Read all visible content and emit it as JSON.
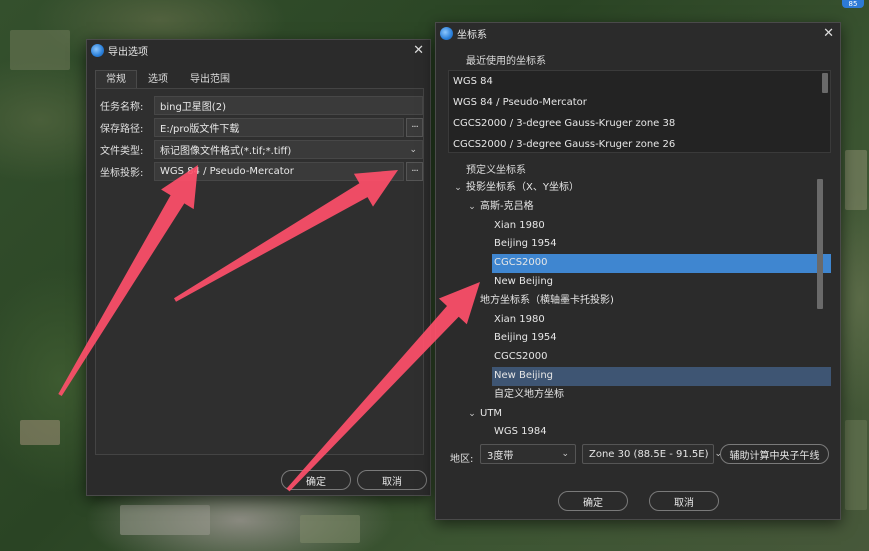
{
  "colors": {
    "arrow": "#ff4f6a",
    "selection": "#3f86d0",
    "selection_muted": "#3e5573"
  },
  "badge": "85",
  "export_dialog": {
    "title": "导出选项",
    "tabs": [
      "常规",
      "选项",
      "导出范围"
    ],
    "fields": {
      "task_name_label": "任务名称:",
      "task_name_value": "bing卫星图(2)",
      "save_path_label": "保存路径:",
      "save_path_value": "E:/pro版文件下载",
      "file_type_label": "文件类型:",
      "file_type_value": "标记图像文件格式(*.tif;*.tiff)",
      "projection_label": "坐标投影:",
      "projection_value": "WGS 84 / Pseudo-Mercator"
    },
    "ok": "确定",
    "cancel": "取消"
  },
  "coord_dialog": {
    "title": "坐标系",
    "recent_title": "最近使用的坐标系",
    "recent": [
      "WGS 84",
      "WGS 84 / Pseudo-Mercator",
      "CGCS2000 / 3-degree Gauss-Kruger zone 38",
      "CGCS2000 / 3-degree Gauss-Kruger zone 26"
    ],
    "predefined_title": "预定义坐标系",
    "tree": [
      {
        "text": "投影坐标系（X、Y坐标）",
        "level": 0,
        "chev": "⌄"
      },
      {
        "text": "高斯-克吕格",
        "level": 1,
        "chev": "⌄"
      },
      {
        "text": "Xian 1980",
        "level": 2
      },
      {
        "text": "Beijing 1954",
        "level": 2
      },
      {
        "text": "CGCS2000",
        "level": 2,
        "sel": "a"
      },
      {
        "text": "New Beijing",
        "level": 2
      },
      {
        "text": "地方坐标系（横轴墨卡托投影)",
        "level": 1
      },
      {
        "text": "Xian 1980",
        "level": 2
      },
      {
        "text": "Beijing 1954",
        "level": 2
      },
      {
        "text": "CGCS2000",
        "level": 2
      },
      {
        "text": "New Beijing",
        "level": 2,
        "sel": "b"
      },
      {
        "text": "自定义地方坐标",
        "level": 2
      },
      {
        "text": "UTM",
        "level": 1,
        "chev": "⌄"
      },
      {
        "text": "WGS 1984",
        "level": 2
      }
    ],
    "region_label": "地区:",
    "band_value": "3度带",
    "zone_value": "Zone 30 (88.5E - 91.5E)",
    "calc_button": "辅助计算中央子午线",
    "ok": "确定",
    "cancel": "取消"
  }
}
